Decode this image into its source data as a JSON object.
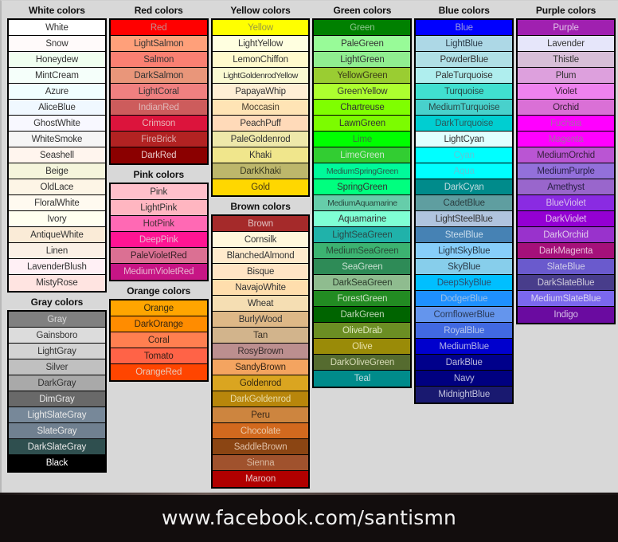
{
  "page": {
    "background": "#d8d8d8",
    "footer_background": "#120d0d"
  },
  "footer": {
    "text": "www.facebook.com/santismn"
  },
  "columns": [
    {
      "name": "column-white-gray",
      "groups": [
        {
          "title": "White colors",
          "swatches": [
            {
              "label": "White",
              "bg": "#FFFFFF",
              "fg": "#333333"
            },
            {
              "label": "Snow",
              "bg": "#FFFAFA",
              "fg": "#333333"
            },
            {
              "label": "Honeydew",
              "bg": "#F0FFF0",
              "fg": "#333333"
            },
            {
              "label": "MintCream",
              "bg": "#F5FFFA",
              "fg": "#333333"
            },
            {
              "label": "Azure",
              "bg": "#F0FFFF",
              "fg": "#333333"
            },
            {
              "label": "AliceBlue",
              "bg": "#F0F8FF",
              "fg": "#333333"
            },
            {
              "label": "GhostWhite",
              "bg": "#F8F8FF",
              "fg": "#333333"
            },
            {
              "label": "WhiteSmoke",
              "bg": "#F5F5F5",
              "fg": "#333333"
            },
            {
              "label": "Seashell",
              "bg": "#FFF5EE",
              "fg": "#333333"
            },
            {
              "label": "Beige",
              "bg": "#F5F5DC",
              "fg": "#333333"
            },
            {
              "label": "OldLace",
              "bg": "#FDF5E6",
              "fg": "#333333"
            },
            {
              "label": "FloralWhite",
              "bg": "#FFFAF0",
              "fg": "#333333"
            },
            {
              "label": "Ivory",
              "bg": "#FFFFF0",
              "fg": "#333333"
            },
            {
              "label": "AntiqueWhite",
              "bg": "#FAEBD7",
              "fg": "#333333"
            },
            {
              "label": "Linen",
              "bg": "#FAF0E6",
              "fg": "#333333"
            },
            {
              "label": "LavenderBlush",
              "bg": "#FFF0F5",
              "fg": "#333333"
            },
            {
              "label": "MistyRose",
              "bg": "#FFE4E1",
              "fg": "#333333"
            }
          ]
        },
        {
          "title": "Gray colors",
          "swatches": [
            {
              "label": "Gray",
              "bg": "#808080",
              "fg": "#d8d8d8"
            },
            {
              "label": "Gainsboro",
              "bg": "#DCDCDC",
              "fg": "#333333"
            },
            {
              "label": "LightGray",
              "bg": "#D3D3D3",
              "fg": "#333333"
            },
            {
              "label": "Silver",
              "bg": "#C0C0C0",
              "fg": "#333333"
            },
            {
              "label": "DarkGray",
              "bg": "#A9A9A9",
              "fg": "#333333"
            },
            {
              "label": "DimGray",
              "bg": "#696969",
              "fg": "#e8e8e8"
            },
            {
              "label": "LightSlateGray",
              "bg": "#778899",
              "fg": "#e8e8e8"
            },
            {
              "label": "SlateGray",
              "bg": "#708090",
              "fg": "#e8e8e8"
            },
            {
              "label": "DarkSlateGray",
              "bg": "#2F4F4F",
              "fg": "#e8e8e8"
            },
            {
              "label": "Black",
              "bg": "#000000",
              "fg": "#ffffff"
            }
          ]
        }
      ]
    },
    {
      "name": "column-red-pink-orange",
      "groups": [
        {
          "title": "Red colors",
          "swatches": [
            {
              "label": "Red",
              "bg": "#FF0000",
              "fg": "#c88a8a"
            },
            {
              "label": "LightSalmon",
              "bg": "#FFA07A",
              "fg": "#333333"
            },
            {
              "label": "Salmon",
              "bg": "#FA8072",
              "fg": "#333333"
            },
            {
              "label": "DarkSalmon",
              "bg": "#E9967A",
              "fg": "#333333"
            },
            {
              "label": "LightCoral",
              "bg": "#F08080",
              "fg": "#333333"
            },
            {
              "label": "IndianRed",
              "bg": "#CD5C5C",
              "fg": "#e0b8b8"
            },
            {
              "label": "Crimson",
              "bg": "#DC143C",
              "fg": "#e8b8b8"
            },
            {
              "label": "FireBrick",
              "bg": "#B22222",
              "fg": "#dba9a9"
            },
            {
              "label": "DarkRed",
              "bg": "#8B0000",
              "fg": "#e8c8c8"
            }
          ]
        },
        {
          "title": "Pink colors",
          "swatches": [
            {
              "label": "Pink",
              "bg": "#FFC0CB",
              "fg": "#333333"
            },
            {
              "label": "LightPink",
              "bg": "#FFB6C1",
              "fg": "#333333"
            },
            {
              "label": "HotPink",
              "bg": "#FF69B4",
              "fg": "#4a3038"
            },
            {
              "label": "DeepPink",
              "bg": "#FF1493",
              "fg": "#e8b8d0"
            },
            {
              "label": "PaleVioletRed",
              "bg": "#DB7093",
              "fg": "#3a2028"
            },
            {
              "label": "MediumVioletRed",
              "bg": "#C71585",
              "fg": "#e8b8d0"
            }
          ]
        },
        {
          "title": "Orange colors",
          "swatches": [
            {
              "label": "Orange",
              "bg": "#FFA500",
              "fg": "#3a2c10"
            },
            {
              "label": "DarkOrange",
              "bg": "#FF8C00",
              "fg": "#3a2810"
            },
            {
              "label": "Coral",
              "bg": "#FF7F50",
              "fg": "#3a2418"
            },
            {
              "label": "Tomato",
              "bg": "#FF6347",
              "fg": "#3a2018"
            },
            {
              "label": "OrangeRed",
              "bg": "#FF4500",
              "fg": "#e8c8b8"
            }
          ]
        }
      ]
    },
    {
      "name": "column-yellow-brown",
      "groups": [
        {
          "title": "Yellow colors",
          "swatches": [
            {
              "label": "Yellow",
              "bg": "#FFFF00",
              "fg": "#9a9a40"
            },
            {
              "label": "LightYellow",
              "bg": "#FFFFE0",
              "fg": "#333333"
            },
            {
              "label": "LemonChiffon",
              "bg": "#FFFACD",
              "fg": "#333333"
            },
            {
              "label": "LightGoldenrodYellow",
              "bg": "#FAFAD2",
              "fg": "#333333"
            },
            {
              "label": "PapayaWhip",
              "bg": "#FFEFD5",
              "fg": "#333333"
            },
            {
              "label": "Moccasin",
              "bg": "#FFE4B5",
              "fg": "#4a4030"
            },
            {
              "label": "PeachPuff",
              "bg": "#FFDAB9",
              "fg": "#333333"
            },
            {
              "label": "PaleGoldenrod",
              "bg": "#EEE8AA",
              "fg": "#333333"
            },
            {
              "label": "Khaki",
              "bg": "#F0E68C",
              "fg": "#333333"
            },
            {
              "label": "DarkKhaki",
              "bg": "#BDB76B",
              "fg": "#3a3a20"
            },
            {
              "label": "Gold",
              "bg": "#FFD700",
              "fg": "#4a3c10"
            }
          ]
        },
        {
          "title": "Brown colors",
          "swatches": [
            {
              "label": "Brown",
              "bg": "#A52A2A",
              "fg": "#e0c0c0"
            },
            {
              "label": "Cornsilk",
              "bg": "#FFF8DC",
              "fg": "#333333"
            },
            {
              "label": "BlanchedAlmond",
              "bg": "#FFEBCD",
              "fg": "#333333"
            },
            {
              "label": "Bisque",
              "bg": "#FFE4C4",
              "fg": "#333333"
            },
            {
              "label": "NavajoWhite",
              "bg": "#FFDEAD",
              "fg": "#333333"
            },
            {
              "label": "Wheat",
              "bg": "#F5DEB3",
              "fg": "#333333"
            },
            {
              "label": "BurlyWood",
              "bg": "#DEB887",
              "fg": "#333333"
            },
            {
              "label": "Tan",
              "bg": "#D2B48C",
              "fg": "#3a3228"
            },
            {
              "label": "RosyBrown",
              "bg": "#BC8F8F",
              "fg": "#3a2e2e"
            },
            {
              "label": "SandyBrown",
              "bg": "#F4A460",
              "fg": "#3a2818"
            },
            {
              "label": "Goldenrod",
              "bg": "#DAA520",
              "fg": "#3a2c10"
            },
            {
              "label": "DarkGoldenrod",
              "bg": "#B8860B",
              "fg": "#e8dca8"
            },
            {
              "label": "Peru",
              "bg": "#CD853F",
              "fg": "#3a2818"
            },
            {
              "label": "Chocolate",
              "bg": "#D2691E",
              "fg": "#e8c8a8"
            },
            {
              "label": "SaddleBrown",
              "bg": "#8B4513",
              "fg": "#e0c0a8"
            },
            {
              "label": "Sienna",
              "bg": "#A0522D",
              "fg": "#d8b8a0"
            },
            {
              "label": "Maroon",
              "bg": "#B00000",
              "fg": "#e8c0c0"
            }
          ]
        }
      ]
    },
    {
      "name": "column-green",
      "groups": [
        {
          "title": "Green colors",
          "swatches": [
            {
              "label": "Green",
              "bg": "#008000",
              "fg": "#8ec88e"
            },
            {
              "label": "PaleGreen",
              "bg": "#98FB98",
              "fg": "#333333"
            },
            {
              "label": "LightGreen",
              "bg": "#90EE90",
              "fg": "#333333"
            },
            {
              "label": "YellowGreen",
              "bg": "#9ACD32",
              "fg": "#3a3a18"
            },
            {
              "label": "GreenYellow",
              "bg": "#ADFF2F",
              "fg": "#333333"
            },
            {
              "label": "Chartreuse",
              "bg": "#7FFF00",
              "fg": "#333333"
            },
            {
              "label": "LawnGreen",
              "bg": "#7CFC00",
              "fg": "#333333"
            },
            {
              "label": "Lime",
              "bg": "#00FF00",
              "fg": "#3a7a3a"
            },
            {
              "label": "LimeGreen",
              "bg": "#32CD32",
              "fg": "#c8e8c8"
            },
            {
              "label": "MediumSpringGreen",
              "bg": "#00FA9A",
              "fg": "#2a5a4a"
            },
            {
              "label": "SpringGreen",
              "bg": "#00FF7F",
              "fg": "#333333"
            },
            {
              "label": "MediumAquamarine",
              "bg": "#66CDAA",
              "fg": "#2a4a40"
            },
            {
              "label": "Aquamarine",
              "bg": "#7FFFD4",
              "fg": "#333333"
            },
            {
              "label": "LightSeaGreen",
              "bg": "#20B2AA",
              "fg": "#2a4a48"
            },
            {
              "label": "MediumSeaGreen",
              "bg": "#3CB371",
              "fg": "#2a4a38"
            },
            {
              "label": "SeaGreen",
              "bg": "#2E8B57",
              "fg": "#c8e0d0"
            },
            {
              "label": "DarkSeaGreen",
              "bg": "#8FBC8F",
              "fg": "#2a3a2a"
            },
            {
              "label": "ForestGreen",
              "bg": "#228B22",
              "fg": "#c8e0c0"
            },
            {
              "label": "DarkGreen",
              "bg": "#006400",
              "fg": "#c0d8b8"
            },
            {
              "label": "OliveDrab",
              "bg": "#6B8E23",
              "fg": "#e0e8c0"
            },
            {
              "label": "Olive",
              "bg": "#9A8B08",
              "fg": "#e8e0a8"
            },
            {
              "label": "DarkOliveGreen",
              "bg": "#556B2F",
              "fg": "#d8dcb8"
            },
            {
              "label": "Teal",
              "bg": "#008B8B",
              "fg": "#c0dce0"
            }
          ]
        }
      ]
    },
    {
      "name": "column-blue",
      "groups": [
        {
          "title": "Blue colors",
          "swatches": [
            {
              "label": "Blue",
              "bg": "#0000FF",
              "fg": "#9a9ae0"
            },
            {
              "label": "LightBlue",
              "bg": "#ADD8E6",
              "fg": "#2a3a48"
            },
            {
              "label": "PowderBlue",
              "bg": "#B0E0E6",
              "fg": "#333333"
            },
            {
              "label": "PaleTurquoise",
              "bg": "#AFEEEE",
              "fg": "#333333"
            },
            {
              "label": "Turquoise",
              "bg": "#40E0D0",
              "fg": "#2a4a48"
            },
            {
              "label": "MediumTurquoise",
              "bg": "#48D1CC",
              "fg": "#2a4a48"
            },
            {
              "label": "DarkTurquoise",
              "bg": "#00CED1",
              "fg": "#2a5a5c"
            },
            {
              "label": "LightCyan",
              "bg": "#E0FFFF",
              "fg": "#333333"
            },
            {
              "label": "Cyan",
              "bg": "#00FFFF",
              "fg": "#5ac8d8"
            },
            {
              "label": "Aqua",
              "bg": "#00FFFF",
              "fg": "#5ac8d8"
            },
            {
              "label": "DarkCyan",
              "bg": "#008B8B",
              "fg": "#c0dce0"
            },
            {
              "label": "CadetBlue",
              "bg": "#5F9EA0",
              "fg": "#2a3e40"
            },
            {
              "label": "LightSteelBlue",
              "bg": "#B0C4DE",
              "fg": "#333333"
            },
            {
              "label": "SteelBlue",
              "bg": "#4682B4",
              "fg": "#c8dcec"
            },
            {
              "label": "LightSkyBlue",
              "bg": "#87CEFA",
              "fg": "#2a3a48"
            },
            {
              "label": "SkyBlue",
              "bg": "#87CEEB",
              "fg": "#2a3a48"
            },
            {
              "label": "DeepSkyBlue",
              "bg": "#00BFFF",
              "fg": "#2a5070"
            },
            {
              "label": "DodgerBlue",
              "bg": "#1E90FF",
              "fg": "#9ac0e8"
            },
            {
              "label": "CornflowerBlue",
              "bg": "#6495ED",
              "fg": "#2a3a58"
            },
            {
              "label": "RoyalBlue",
              "bg": "#4169E1",
              "fg": "#b8c8ec"
            },
            {
              "label": "MediumBlue",
              "bg": "#0000CD",
              "fg": "#b0b0e8"
            },
            {
              "label": "DarkBlue",
              "bg": "#00008B",
              "fg": "#b8b8dc"
            },
            {
              "label": "Navy",
              "bg": "#000080",
              "fg": "#b8b8dc"
            },
            {
              "label": "MidnightBlue",
              "bg": "#191970",
              "fg": "#c0c0dc"
            }
          ]
        }
      ]
    },
    {
      "name": "column-purple",
      "groups": [
        {
          "title": "Purple colors",
          "swatches": [
            {
              "label": "Purple",
              "bg": "#A020B0",
              "fg": "#e0c0e8"
            },
            {
              "label": "Lavender",
              "bg": "#E6E6FA",
              "fg": "#333333"
            },
            {
              "label": "Thistle",
              "bg": "#D8BFD8",
              "fg": "#333333"
            },
            {
              "label": "Plum",
              "bg": "#DDA0DD",
              "fg": "#333333"
            },
            {
              "label": "Violet",
              "bg": "#EE82EE",
              "fg": "#3a2038"
            },
            {
              "label": "Orchid",
              "bg": "#DA70D6",
              "fg": "#3a2038"
            },
            {
              "label": "Fuchsia",
              "bg": "#FF00FF",
              "fg": "#a868a8"
            },
            {
              "label": "Magenta",
              "bg": "#FF00FF",
              "fg": "#a868a8"
            },
            {
              "label": "MediumOrchid",
              "bg": "#BA55D3",
              "fg": "#3a2040"
            },
            {
              "label": "MediumPurple",
              "bg": "#9370DB",
              "fg": "#2a2048"
            },
            {
              "label": "Amethyst",
              "bg": "#9966CC",
              "fg": "#2a2048"
            },
            {
              "label": "BlueViolet",
              "bg": "#8A2BE2",
              "fg": "#d8c0ec"
            },
            {
              "label": "DarkViolet",
              "bg": "#9400D3",
              "fg": "#e0c0ec"
            },
            {
              "label": "DarkOrchid",
              "bg": "#9932CC",
              "fg": "#e0c8ec"
            },
            {
              "label": "DarkMagenta",
              "bg": "#A5107A",
              "fg": "#e8c0dc"
            },
            {
              "label": "SlateBlue",
              "bg": "#6A5ACD",
              "fg": "#d0cce8"
            },
            {
              "label": "DarkSlateBlue",
              "bg": "#483D8B",
              "fg": "#d0ccdc"
            },
            {
              "label": "MediumSlateBlue",
              "bg": "#7B68EE",
              "fg": "#d8d4f0"
            },
            {
              "label": "Indigo",
              "bg": "#6A0BA0",
              "fg": "#d8c0e8"
            }
          ]
        }
      ]
    }
  ]
}
